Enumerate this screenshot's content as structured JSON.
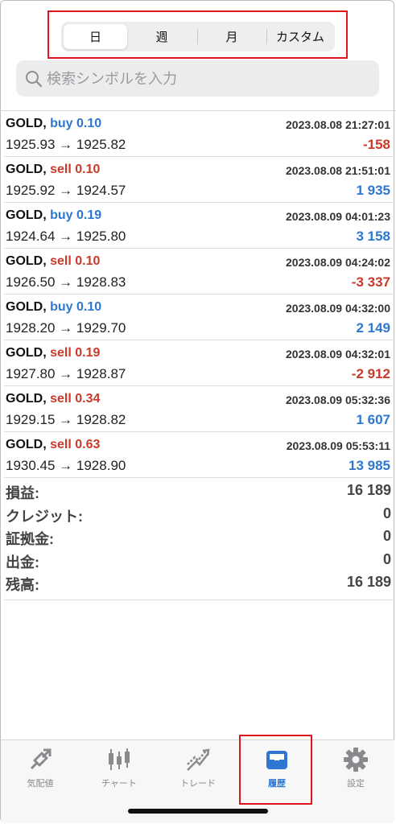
{
  "segments": [
    "日",
    "週",
    "月",
    "カスタム"
  ],
  "search": {
    "placeholder": "検索シンボルを入力"
  },
  "trades": [
    {
      "symbol": "GOLD,",
      "side": "buy",
      "lots": "0.10",
      "time": "2023.08.08 21:27:01",
      "prices": "1925.93 → 1925.82",
      "pl": "-158",
      "pl_sign": "neg"
    },
    {
      "symbol": "GOLD,",
      "side": "sell",
      "lots": "0.10",
      "time": "2023.08.08 21:51:01",
      "prices": "1925.92 → 1924.57",
      "pl": "1 935",
      "pl_sign": "pos"
    },
    {
      "symbol": "GOLD,",
      "side": "buy",
      "lots": "0.19",
      "time": "2023.08.09 04:01:23",
      "prices": "1924.64 → 1925.80",
      "pl": "3 158",
      "pl_sign": "pos"
    },
    {
      "symbol": "GOLD,",
      "side": "sell",
      "lots": "0.10",
      "time": "2023.08.09 04:24:02",
      "prices": "1926.50 → 1928.83",
      "pl": "-3 337",
      "pl_sign": "neg"
    },
    {
      "symbol": "GOLD,",
      "side": "buy",
      "lots": "0.10",
      "time": "2023.08.09 04:32:00",
      "prices": "1928.20 → 1929.70",
      "pl": "2 149",
      "pl_sign": "pos"
    },
    {
      "symbol": "GOLD,",
      "side": "sell",
      "lots": "0.19",
      "time": "2023.08.09 04:32:01",
      "prices": "1927.80 → 1928.87",
      "pl": "-2 912",
      "pl_sign": "neg"
    },
    {
      "symbol": "GOLD,",
      "side": "sell",
      "lots": "0.34",
      "time": "2023.08.09 05:32:36",
      "prices": "1929.15 → 1928.82",
      "pl": "1 607",
      "pl_sign": "pos"
    },
    {
      "symbol": "GOLD,",
      "side": "sell",
      "lots": "0.63",
      "time": "2023.08.09 05:53:11",
      "prices": "1930.45 → 1928.90",
      "pl": "13 985",
      "pl_sign": "pos"
    }
  ],
  "summary": [
    {
      "label": "損益:",
      "value": "16 189"
    },
    {
      "label": "クレジット:",
      "value": "0"
    },
    {
      "label": "証拠金:",
      "value": "0"
    },
    {
      "label": "出金:",
      "value": "0"
    },
    {
      "label": "残高:",
      "value": "16 189"
    }
  ],
  "tabs": [
    {
      "label": "気配値",
      "icon": "quotes-icon"
    },
    {
      "label": "チャート",
      "icon": "candlestick-icon"
    },
    {
      "label": "トレード",
      "icon": "trade-icon"
    },
    {
      "label": "履歴",
      "icon": "history-tray-icon"
    },
    {
      "label": "設定",
      "icon": "gear-icon"
    }
  ],
  "colors": {
    "accent": "#2e77d0",
    "sell": "#c83a2a",
    "highlight_box": "#e0161e"
  }
}
